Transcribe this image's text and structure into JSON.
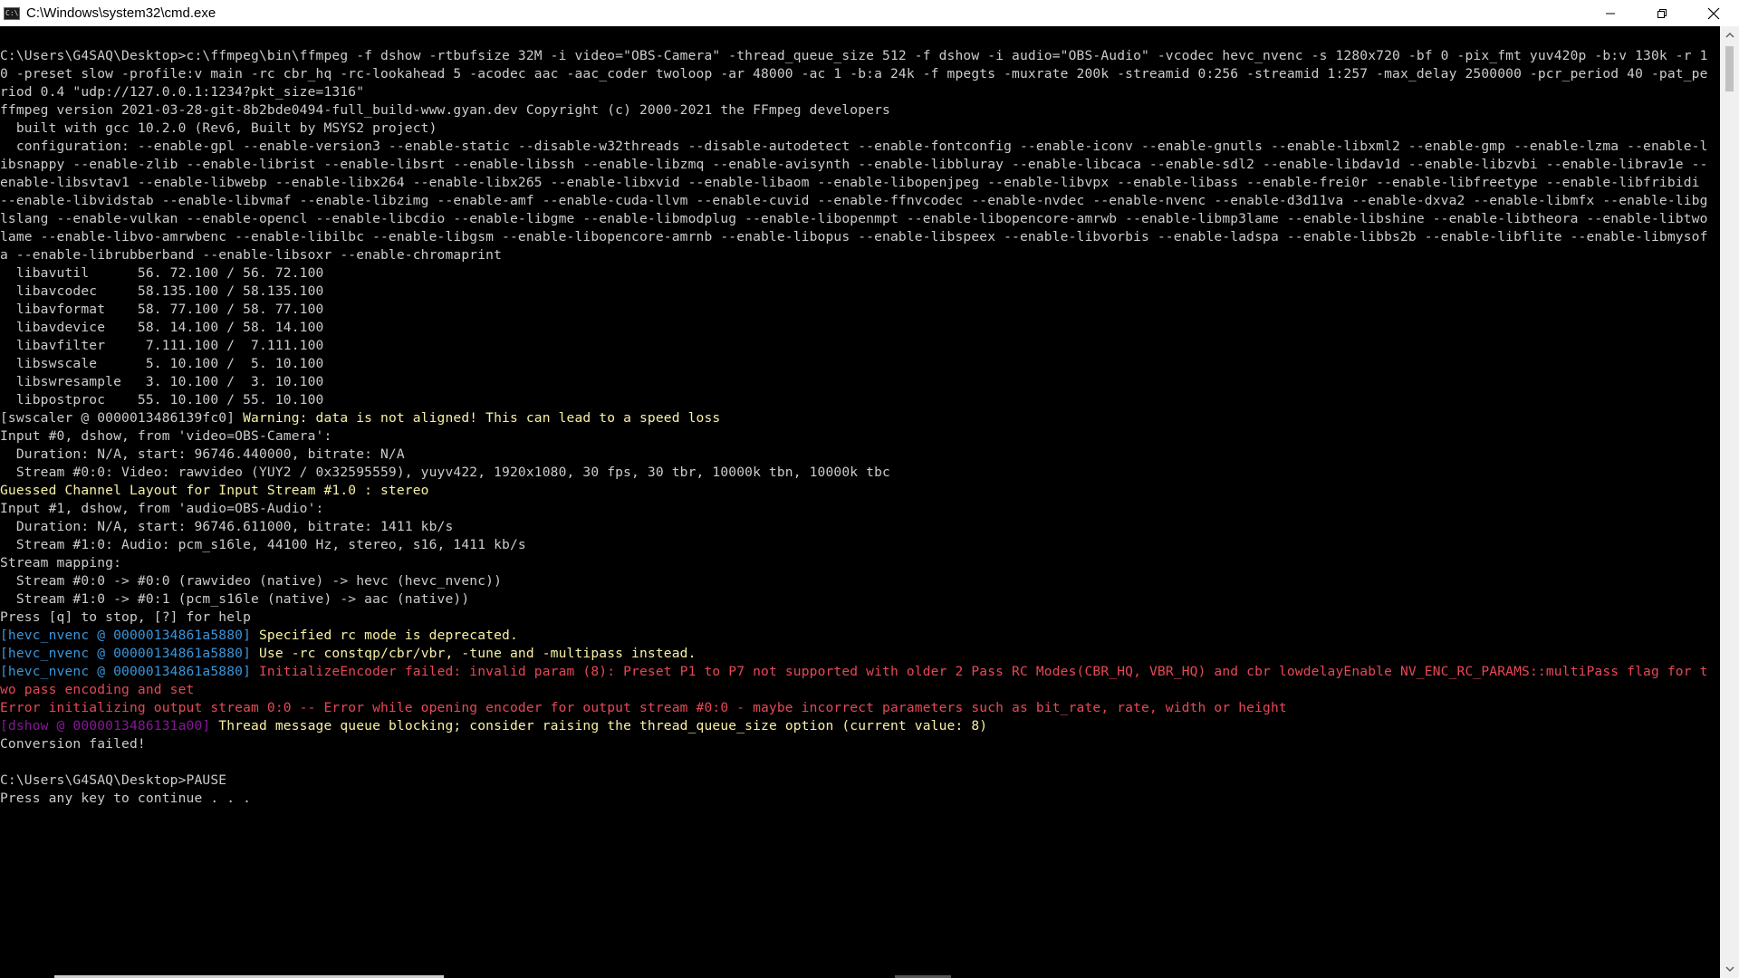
{
  "window": {
    "title": "C:\\Windows\\system32\\cmd.exe",
    "icon": "cmd-icon",
    "icon_text": "C:\\"
  },
  "colors": {
    "background": "#000000",
    "text": "#cccccc",
    "yellow": "#f9f1a5",
    "cyan": "#3a96dd",
    "red": "#e74856",
    "purple": "#881798"
  },
  "console": {
    "lines": [
      [
        {
          "t": "C:\\Users\\G4SAQ\\Desktop>c:\\ffmpeg\\bin\\ffmpeg -f dshow -rtbufsize 32M -i video=\"OBS-Camera\" -thread_queue_size 512 -f dshow -i audio=\"OBS-Audio\" -vcodec hevc_nvenc -s 1280x720 -bf 0 -pix_fmt yuv420p -b:v 130k -r 1",
          "c": "white"
        }
      ],
      [
        {
          "t": "0 -preset slow -profile:v main -rc cbr_hq -rc-lookahead 5 -acodec aac -aac_coder twoloop -ar 48000 -ac 1 -b:a 24k -f mpegts -muxrate 200k -streamid 0:256 -streamid 1:257 -max_delay 2500000 -pcr_period 40 -pat_pe",
          "c": "white"
        }
      ],
      [
        {
          "t": "riod 0.4 \"udp://127.0.0.1:1234?pkt_size=1316\"",
          "c": "white"
        }
      ],
      [
        {
          "t": "ffmpeg version 2021-03-28-git-8b2bde0494-full_build-www.gyan.dev Copyright (c) 2000-2021 the FFmpeg developers",
          "c": "white"
        }
      ],
      [
        {
          "t": "  built with gcc 10.2.0 (Rev6, Built by MSYS2 project)",
          "c": "white"
        }
      ],
      [
        {
          "t": "  configuration: --enable-gpl --enable-version3 --enable-static --disable-w32threads --disable-autodetect --enable-fontconfig --enable-iconv --enable-gnutls --enable-libxml2 --enable-gmp --enable-lzma --enable-l",
          "c": "white"
        }
      ],
      [
        {
          "t": "ibsnappy --enable-zlib --enable-librist --enable-libsrt --enable-libssh --enable-libzmq --enable-avisynth --enable-libbluray --enable-libcaca --enable-sdl2 --enable-libdav1d --enable-libzvbi --enable-librav1e --",
          "c": "white"
        }
      ],
      [
        {
          "t": "enable-libsvtav1 --enable-libwebp --enable-libx264 --enable-libx265 --enable-libxvid --enable-libaom --enable-libopenjpeg --enable-libvpx --enable-libass --enable-frei0r --enable-libfreetype --enable-libfribidi",
          "c": "white"
        }
      ],
      [
        {
          "t": "--enable-libvidstab --enable-libvmaf --enable-libzimg --enable-amf --enable-cuda-llvm --enable-cuvid --enable-ffnvcodec --enable-nvdec --enable-nvenc --enable-d3d11va --enable-dxva2 --enable-libmfx --enable-libg",
          "c": "white"
        }
      ],
      [
        {
          "t": "lslang --enable-vulkan --enable-opencl --enable-libcdio --enable-libgme --enable-libmodplug --enable-libopenmpt --enable-libopencore-amrwb --enable-libmp3lame --enable-libshine --enable-libtheora --enable-libtwo",
          "c": "white"
        }
      ],
      [
        {
          "t": "lame --enable-libvo-amrwbenc --enable-libilbc --enable-libgsm --enable-libopencore-amrnb --enable-libopus --enable-libspeex --enable-libvorbis --enable-ladspa --enable-libbs2b --enable-libflite --enable-libmysof",
          "c": "white"
        }
      ],
      [
        {
          "t": "a --enable-librubberband --enable-libsoxr --enable-chromaprint",
          "c": "white"
        }
      ],
      [
        {
          "t": "  libavutil      56. 72.100 / 56. 72.100",
          "c": "white"
        }
      ],
      [
        {
          "t": "  libavcodec     58.135.100 / 58.135.100",
          "c": "white"
        }
      ],
      [
        {
          "t": "  libavformat    58. 77.100 / 58. 77.100",
          "c": "white"
        }
      ],
      [
        {
          "t": "  libavdevice    58. 14.100 / 58. 14.100",
          "c": "white"
        }
      ],
      [
        {
          "t": "  libavfilter     7.111.100 /  7.111.100",
          "c": "white"
        }
      ],
      [
        {
          "t": "  libswscale      5. 10.100 /  5. 10.100",
          "c": "white"
        }
      ],
      [
        {
          "t": "  libswresample   3. 10.100 /  3. 10.100",
          "c": "white"
        }
      ],
      [
        {
          "t": "  libpostproc    55. 10.100 / 55. 10.100",
          "c": "white"
        }
      ],
      [
        {
          "t": "[swscaler @ 0000013486139fc0] ",
          "c": "white"
        },
        {
          "t": "Warning: data is not aligned! This can lead to a speed loss",
          "c": "yellow"
        }
      ],
      [
        {
          "t": "Input #0, dshow, from 'video=OBS-Camera':",
          "c": "white"
        }
      ],
      [
        {
          "t": "  Duration: N/A, start: 96746.440000, bitrate: N/A",
          "c": "white"
        }
      ],
      [
        {
          "t": "  Stream #0:0: Video: rawvideo (YUY2 / 0x32595559), yuyv422, 1920x1080, 30 fps, 30 tbr, 10000k tbn, 10000k tbc",
          "c": "white"
        }
      ],
      [
        {
          "t": "Guessed Channel Layout for Input Stream #1.0 : stereo",
          "c": "yellow"
        }
      ],
      [
        {
          "t": "Input #1, dshow, from 'audio=OBS-Audio':",
          "c": "white"
        }
      ],
      [
        {
          "t": "  Duration: N/A, start: 96746.611000, bitrate: 1411 kb/s",
          "c": "white"
        }
      ],
      [
        {
          "t": "  Stream #1:0: Audio: pcm_s16le, 44100 Hz, stereo, s16, 1411 kb/s",
          "c": "white"
        }
      ],
      [
        {
          "t": "Stream mapping:",
          "c": "white"
        }
      ],
      [
        {
          "t": "  Stream #0:0 -> #0:0 (rawvideo (native) -> hevc (hevc_nvenc))",
          "c": "white"
        }
      ],
      [
        {
          "t": "  Stream #1:0 -> #0:1 (pcm_s16le (native) -> aac (native))",
          "c": "white"
        }
      ],
      [
        {
          "t": "Press [q] to stop, [?] for help",
          "c": "white"
        }
      ],
      [
        {
          "t": "[hevc_nvenc @ 00000134861a5880] ",
          "c": "cyan"
        },
        {
          "t": "Specified rc mode is deprecated.",
          "c": "yellow"
        }
      ],
      [
        {
          "t": "[hevc_nvenc @ 00000134861a5880] ",
          "c": "cyan"
        },
        {
          "t": "Use -rc constqp/cbr/vbr, -tune and -multipass instead.",
          "c": "yellow"
        }
      ],
      [
        {
          "t": "[hevc_nvenc @ 00000134861a5880] ",
          "c": "cyan"
        },
        {
          "t": "InitializeEncoder failed: invalid param (8): Preset P1 to P7 not supported with older 2 Pass RC Modes(CBR_HQ, VBR_HQ) and cbr lowdelayEnable NV_ENC_RC_PARAMS::multiPass flag for t",
          "c": "red"
        }
      ],
      [
        {
          "t": "wo pass encoding and set",
          "c": "red"
        }
      ],
      [
        {
          "t": "Error initializing output stream 0:0 -- Error while opening encoder for output stream #0:0 - maybe incorrect parameters such as bit_rate, rate, width or height",
          "c": "red"
        }
      ],
      [
        {
          "t": "[dshow @ 0000013486131a00] ",
          "c": "purple"
        },
        {
          "t": "Thread message queue blocking; consider raising the thread_queue_size option (current value: 8)",
          "c": "yellow"
        }
      ],
      [
        {
          "t": "Conversion failed!",
          "c": "white"
        }
      ],
      [
        {
          "t": "",
          "c": "white"
        }
      ],
      [
        {
          "t": "C:\\Users\\G4SAQ\\Desktop>PAUSE",
          "c": "white"
        }
      ],
      [
        {
          "t": "Press any key to continue . . .",
          "c": "white"
        }
      ]
    ]
  }
}
